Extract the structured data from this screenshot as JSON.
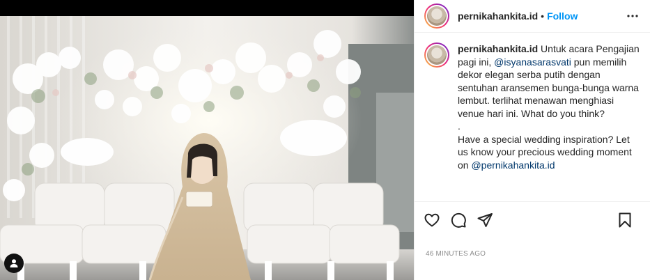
{
  "header": {
    "username": "pernikahankita.id",
    "separator": "•",
    "follow_label": "Follow"
  },
  "caption": {
    "username": "pernikahankita.id",
    "part1": " Untuk acara Pengajian pagi ini, ",
    "mention1": "@isyanasarasvati",
    "part2": " pun memilih dekor elegan serba putih dengan sentuhan aransemen bunga-bunga warna lembut. terlihat menawan menghiasi venue hari ini. What do you think?\n.\nHave a special wedding inspiration? Let us know your precious wedding moment on ",
    "mention2": "@pernikahankita.id"
  },
  "timestamp": "46 MINUTES AGO",
  "icons": {
    "like": "heart-icon",
    "comment": "comment-icon",
    "share": "paper-plane-icon",
    "save": "bookmark-icon",
    "more": "more-options-icon",
    "tag": "user-tag-icon"
  },
  "colors": {
    "follow": "#0095f6",
    "mention": "#00376b",
    "text": "#262626",
    "muted": "#8e8e8e"
  }
}
